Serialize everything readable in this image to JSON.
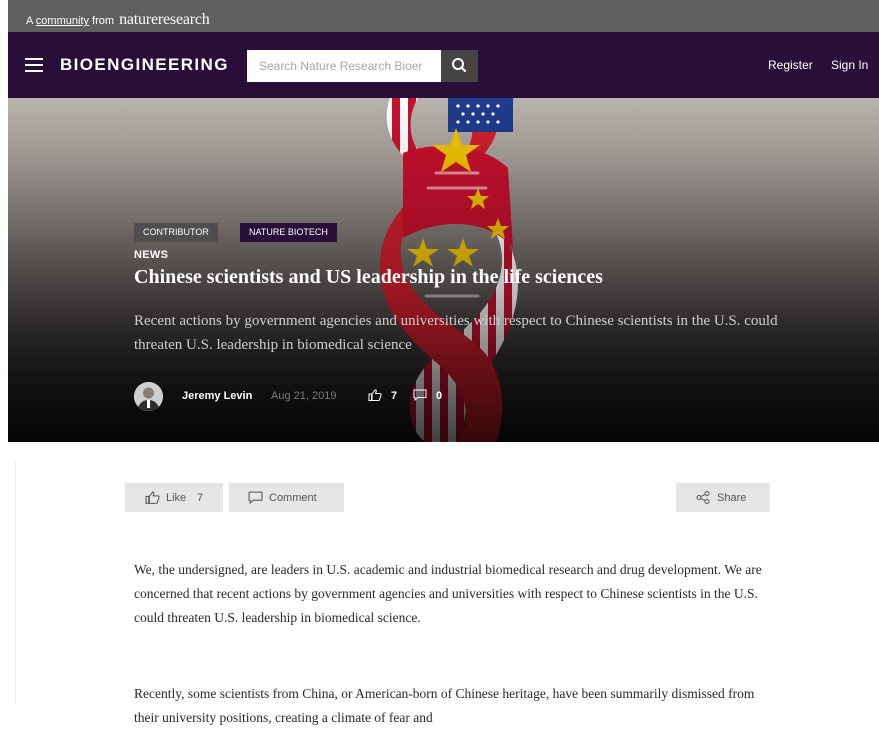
{
  "topbar": {
    "prefix": "A",
    "community_link": "community",
    "from": "from",
    "brand": "natureresearch"
  },
  "header": {
    "site_name": "BIOENGINEERING",
    "search_placeholder": "Search Nature Research Bioer",
    "register": "Register",
    "sign_in": "Sign In"
  },
  "article_header": {
    "badges": [
      "CONTRIBUTOR",
      "NATURE BIOTECH"
    ],
    "category": "NEWS",
    "title": "Chinese scientists and US leadership in the life sciences",
    "subtitle": "Recent actions by government agencies and universities with respect to Chinese scientists in the U.S. could threaten U.S. leadership in biomedical science",
    "author": "Jeremy Levin",
    "date": "Aug 21, 2019",
    "likes": "7",
    "comments": "0"
  },
  "actions": {
    "like_label": "Like",
    "like_count": "7",
    "comment_label": "Comment",
    "share_label": "Share"
  },
  "body": {
    "paragraphs": [
      "We, the undersigned, are leaders in U.S. academic and industrial biomedical research and drug development. We are concerned that recent actions by government agencies and universities with respect to Chinese scientists in the U.S. could threaten U.S. leadership in biomedical science.",
      "Recently, some scientists from China, or American-born of Chinese heritage, have been summarily dismissed from their university positions, creating a climate of fear and"
    ]
  },
  "colors": {
    "nav_background": "#2a0e3a",
    "top_strip": "#5f5f5f",
    "button_background": "#e6e6e6"
  },
  "icons": [
    "menu-icon",
    "search-icon",
    "thumbs-up-icon",
    "comment-icon",
    "share-icon"
  ]
}
